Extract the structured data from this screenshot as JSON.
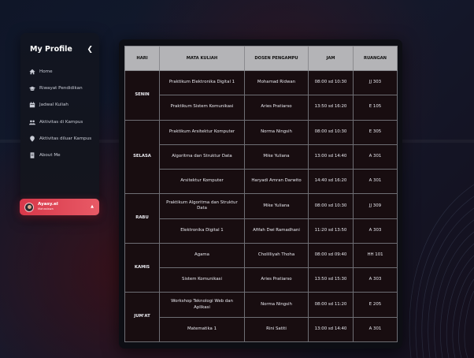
{
  "sidebar": {
    "title": "My Profile",
    "collapse_icon": "chevron-left-icon",
    "items": [
      {
        "label": "Home",
        "icon": "home-icon"
      },
      {
        "label": "Riwayat Pendidikan",
        "icon": "graduation-cap-icon"
      },
      {
        "label": "Jadwal Kuliah",
        "icon": "calendar-icon"
      },
      {
        "label": "Aktivitas di Kampus",
        "icon": "group-icon"
      },
      {
        "label": "Aktivitas diluar Kampus",
        "icon": "location-pin-icon"
      },
      {
        "label": "About Me",
        "icon": "document-icon"
      }
    ]
  },
  "user": {
    "name": "Ayasy.el",
    "role": "Mahasiswa"
  },
  "schedule": {
    "headers": [
      "HARI",
      "MATA KULIAH",
      "DOSEN PENGAMPU",
      "JAM",
      "RUANGAN"
    ],
    "days": [
      {
        "day": "SENIN",
        "rows": [
          {
            "course": "Praktikum Elektronika Digital 1",
            "lecturer": "Mohamad Ridwan",
            "time": "08:00 sd 10:30",
            "room": "JJ 303"
          },
          {
            "course": "Praktikum Sistem Komunikasi",
            "lecturer": "Aries Pratiarso",
            "time": "13:50 sd 16:20",
            "room": "E 105"
          }
        ]
      },
      {
        "day": "SELASA",
        "rows": [
          {
            "course": "Praktikum Arsitektur Komputer",
            "lecturer": "Norma Ningsih",
            "time": "08:00 sd 10:30",
            "room": "E 305"
          },
          {
            "course": "Algoritma dan Struktur Data",
            "lecturer": "Mike Yuliana",
            "time": "13:00 sd 14:40",
            "room": "A 301"
          },
          {
            "course": "Arsitektur Komputer",
            "lecturer": "Haryadi Amran Darwito",
            "time": "14:40 sd 16:20",
            "room": "A 301"
          }
        ]
      },
      {
        "day": "RABU",
        "rows": [
          {
            "course": "Praktikum Algoritma dan Struktur Data",
            "lecturer": "Mike Yuliana",
            "time": "08:00 sd 10:30",
            "room": "JJ 309"
          },
          {
            "course": "Elektronika Digital 1",
            "lecturer": "Afifah Dwi Ramadhani",
            "time": "11:20 sd 13:50",
            "room": "A 303"
          }
        ]
      },
      {
        "day": "KAMIS",
        "rows": [
          {
            "course": "Agama",
            "lecturer": "Cholilliyah Thoha",
            "time": "08:00 sd 09:40",
            "room": "HH 101"
          },
          {
            "course": "Sistem Komunikasi",
            "lecturer": "Aries Pratiarso",
            "time": "13:50 sd 15:30",
            "room": "A 303"
          }
        ]
      },
      {
        "day": "JUM'AT",
        "rows": [
          {
            "course": "Workshop Teknologi Web dan Aplikasi",
            "lecturer": "Norma Ningsih",
            "time": "08:00 sd 11:20",
            "room": "E 205"
          },
          {
            "course": "Matematika 1",
            "lecturer": "Rini Satiti",
            "time": "13:00 sd 14:40",
            "room": "A 301"
          }
        ]
      }
    ]
  }
}
